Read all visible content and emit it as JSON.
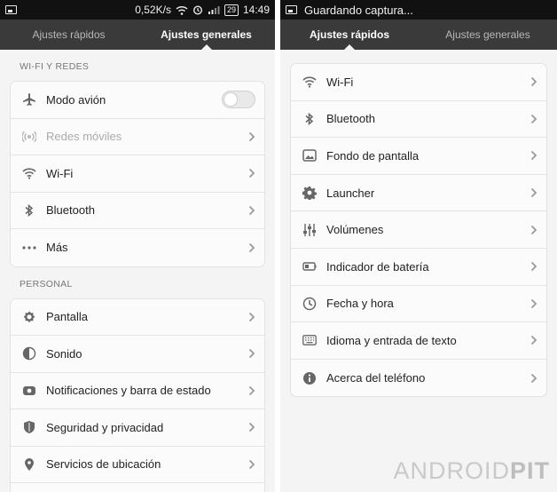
{
  "left": {
    "status": {
      "speed": "0,52K/s",
      "time": "14:49",
      "battery": "29"
    },
    "tabs": [
      {
        "label": "Ajustes rápidos",
        "active": false
      },
      {
        "label": "Ajustes generales",
        "active": true
      }
    ],
    "sections": [
      {
        "title": "WI-FI Y REDES",
        "items": [
          {
            "label": "Modo avión",
            "icon": "airplane-icon",
            "control": "toggle",
            "toggle_on": false
          },
          {
            "label": "Redes móviles",
            "icon": "mobile-network-icon",
            "control": "chevron",
            "disabled": true
          },
          {
            "label": "Wi-Fi",
            "icon": "wifi-icon",
            "control": "chevron"
          },
          {
            "label": "Bluetooth",
            "icon": "bluetooth-icon",
            "control": "chevron"
          },
          {
            "label": "Más",
            "icon": "more-dots-icon",
            "control": "chevron"
          }
        ]
      },
      {
        "title": "PERSONAL",
        "items": [
          {
            "label": "Pantalla",
            "icon": "brightness-icon",
            "control": "chevron"
          },
          {
            "label": "Sonido",
            "icon": "speaker-icon",
            "control": "chevron"
          },
          {
            "label": "Notificaciones y barra de estado",
            "icon": "notification-icon",
            "control": "chevron"
          },
          {
            "label": "Seguridad y privacidad",
            "icon": "shield-icon",
            "control": "chevron"
          },
          {
            "label": "Servicios de ubicación",
            "icon": "location-pin-icon",
            "control": "chevron"
          }
        ]
      }
    ]
  },
  "right": {
    "status": {
      "notification": "Guardando captura..."
    },
    "tabs": [
      {
        "label": "Ajustes rápidos",
        "active": true
      },
      {
        "label": "Ajustes generales",
        "active": false
      }
    ],
    "items": [
      {
        "label": "Wi-Fi",
        "icon": "wifi-icon"
      },
      {
        "label": "Bluetooth",
        "icon": "bluetooth-icon"
      },
      {
        "label": "Fondo de pantalla",
        "icon": "wallpaper-icon"
      },
      {
        "label": "Launcher",
        "icon": "gear-icon"
      },
      {
        "label": "Volúmenes",
        "icon": "sliders-icon"
      },
      {
        "label": "Indicador de batería",
        "icon": "battery-icon"
      },
      {
        "label": "Fecha y hora",
        "icon": "clock-icon"
      },
      {
        "label": "Idioma y entrada de texto",
        "icon": "keyboard-icon"
      },
      {
        "label": "Acerca del teléfono",
        "icon": "info-icon"
      }
    ]
  },
  "watermark": {
    "part1": "ANDROID",
    "part2": "PIT"
  },
  "colors": {
    "status_bar": "#111111",
    "tab_bar": "#3a3a3a",
    "background": "#f4f4f4",
    "card": "#fbfbfb",
    "text": "#222222",
    "icon": "#666666"
  }
}
